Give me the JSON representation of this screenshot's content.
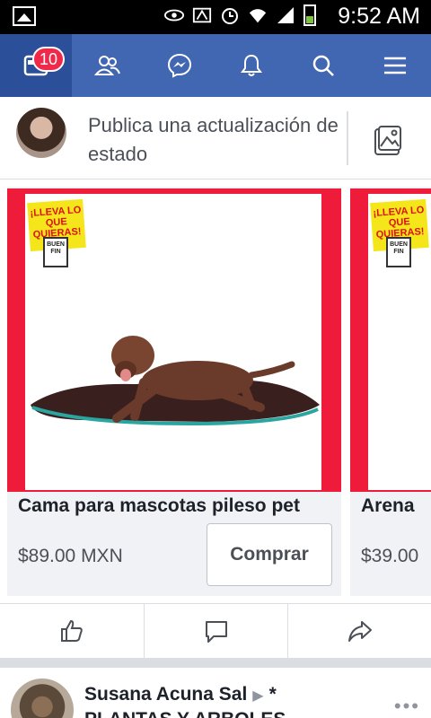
{
  "status_bar": {
    "time": "9:52 AM",
    "icons": [
      "image-notification-icon",
      "eye-icon",
      "nfc-icon",
      "alarm-icon",
      "wifi-icon",
      "signal-icon",
      "battery-icon"
    ]
  },
  "nav": {
    "items": [
      "news-feed-icon",
      "friends-icon",
      "messenger-icon",
      "notifications-icon",
      "search-icon",
      "menu-icon"
    ],
    "feed_badge": "10",
    "color": "#4267b2",
    "active_color": "#2b4f98"
  },
  "composer": {
    "placeholder": "Publica una actualización de estado"
  },
  "products": [
    {
      "title": "Cama para mascotas pileso pet",
      "price": "$89.00 MXN",
      "button": "Comprar",
      "promo_label": "¡LLEVA LO QUE QUIERAS!",
      "promo_sub": "BUEN FIN"
    },
    {
      "title": "Arena",
      "price": "$39.00",
      "promo_label": "¡LLEVA LO QUE QUIERAS!",
      "promo_sub": "BUEN FIN"
    }
  ],
  "actions": [
    "like-icon",
    "comment-icon",
    "share-icon"
  ],
  "next_post": {
    "author": "Susana Acuna Sal",
    "separator": "▶",
    "suffix": "*",
    "line2": "PLANTAS Y ARBOLES"
  },
  "colors": {
    "accent": "#4267b2",
    "badge": "#f02849",
    "promo_red": "#ee1c3a"
  }
}
